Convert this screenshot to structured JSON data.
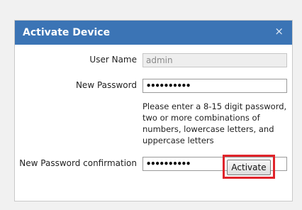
{
  "dialog": {
    "title": "Activate Device",
    "close_symbol": "×",
    "user_name": {
      "label": "User Name",
      "value": "admin"
    },
    "new_password": {
      "label": "New Password",
      "value": "••••••••••"
    },
    "hint": "Please enter a 8-15 digit password, two or more combinations of numbers, lowercase letters, and uppercase letters",
    "confirm_password": {
      "label": "New Password confirmation",
      "value": "••••••••••"
    },
    "activate_label": "Activate"
  },
  "colors": {
    "titlebar": "#3b74b5",
    "highlight": "#e0242b"
  }
}
